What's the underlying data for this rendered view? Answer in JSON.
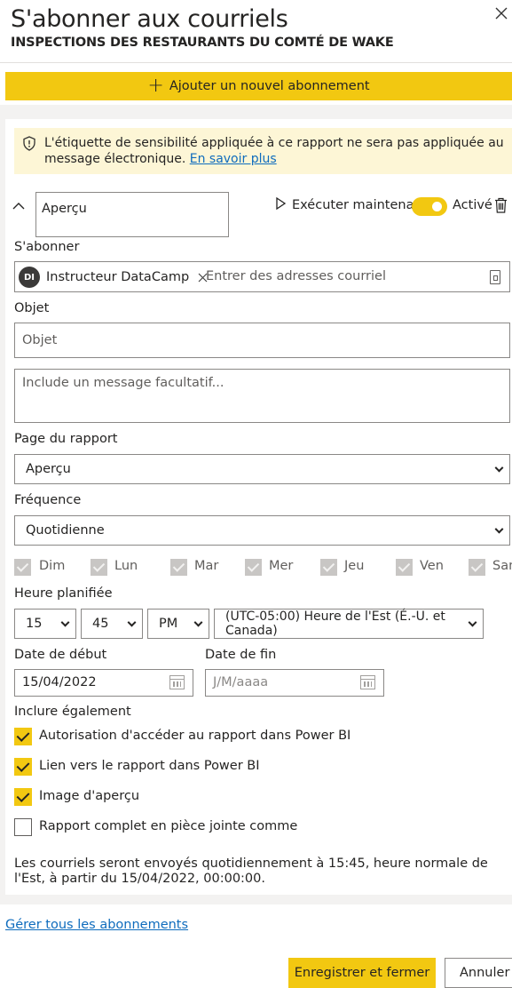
{
  "header": {
    "title": "S'abonner aux courriels",
    "subtitle": "INSPECTIONS DES RESTAURANTS DU COMTÉ DE WAKE",
    "close_icon": "close-icon"
  },
  "add_subscription": {
    "label": "Ajouter un nouvel abonnement",
    "icon": "plus-icon"
  },
  "notice": {
    "text": "L'étiquette de sensibilité appliquée à ce rapport ne sera pas appliquée au message électronique.",
    "link": "En savoir plus",
    "icon": "shield-icon"
  },
  "subscription": {
    "name_value": "Aperçu",
    "run_now_label": "Exécuter maintenant",
    "toggle_label": "Activé",
    "toggle_on": true
  },
  "subscribe": {
    "label": "S'abonner",
    "chip_initials": "DI",
    "chip_name": "Instructeur DataCamp",
    "placeholder": "Entrer des adresses courriel"
  },
  "subject": {
    "label": "Objet",
    "placeholder": "Objet"
  },
  "message": {
    "placeholder": "Include un message facultatif..."
  },
  "report_page": {
    "label": "Page du rapport",
    "value": "Aperçu"
  },
  "frequency": {
    "label": "Fréquence",
    "value": "Quotidienne"
  },
  "days": [
    "Dim",
    "Lun",
    "Mar",
    "Mer",
    "Jeu",
    "Ven",
    "Sam"
  ],
  "schedule": {
    "label": "Heure planifiée",
    "hour": "15",
    "minute": "45",
    "period": "PM",
    "timezone": "(UTC-05:00) Heure de l'Est (É.-U. et Canada)"
  },
  "dates": {
    "start_label": "Date de début",
    "start_value": "15/04/2022",
    "end_label": "Date de fin",
    "end_placeholder": "J/M/aaaa"
  },
  "include": {
    "label": "Inclure également",
    "options": [
      {
        "label": "Autorisation d'accéder au rapport dans Power BI",
        "checked": true
      },
      {
        "label": "Lien vers le rapport dans Power BI",
        "checked": true
      },
      {
        "label": "Image d'aperçu",
        "checked": true
      },
      {
        "label": "Rapport complet en pièce jointe comme",
        "checked": false
      }
    ]
  },
  "summary": "Les courriels seront envoyés quotidiennement à 15:45, heure normale de l'Est, à partir du 15/04/2022, 00:00:00.",
  "manage_link": "Gérer tous les abonnements",
  "footer": {
    "save_label": "Enregistrer et fermer",
    "cancel_label": "Annuler"
  },
  "colors": {
    "accent": "#f2c811",
    "link": "#0f6cbd",
    "notice_bg": "#fdf6d6"
  }
}
